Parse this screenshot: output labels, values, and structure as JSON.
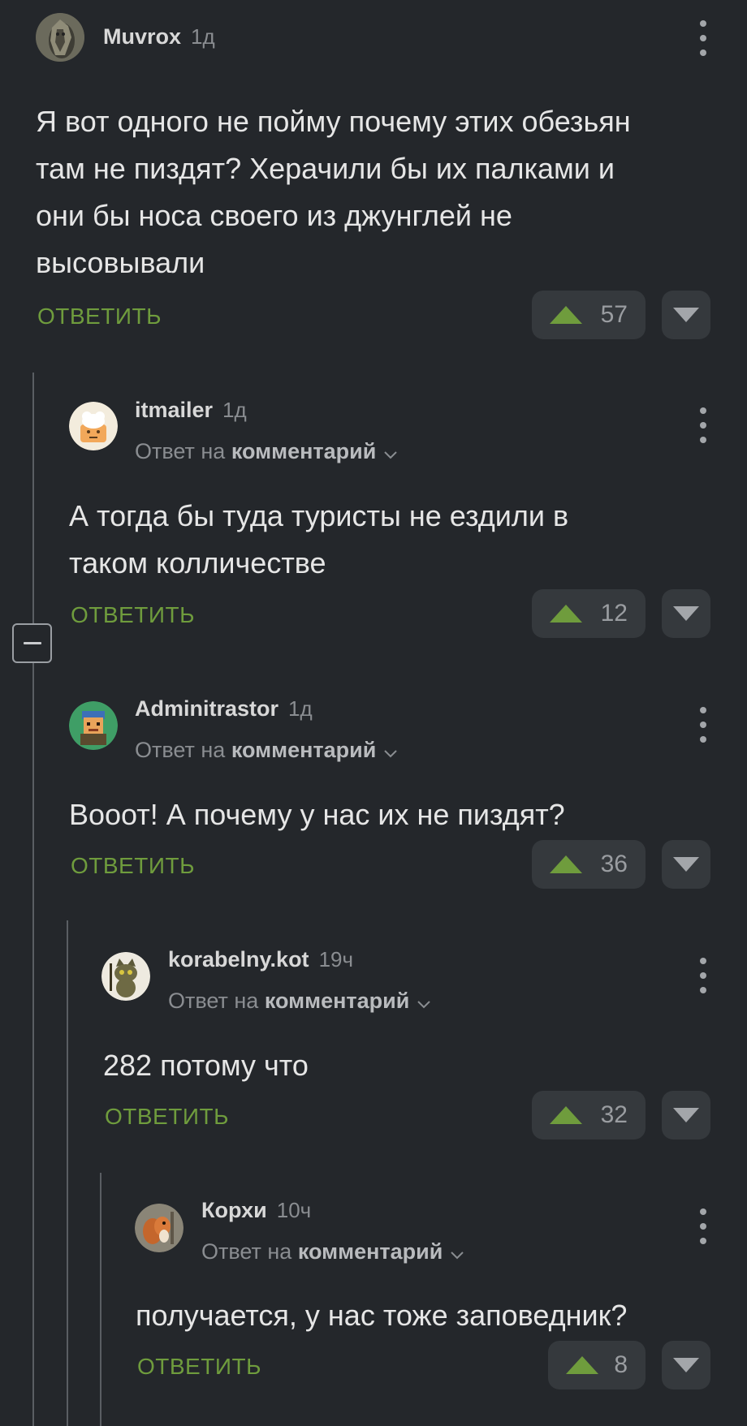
{
  "labels": {
    "reply_prefix": "Ответ на",
    "reply_target": "комментарий",
    "reply_action": "ОТВЕТИТЬ"
  },
  "comments": [
    {
      "username": "Muvrox",
      "time": "1д",
      "avatar_icon": "creature-avatar-icon",
      "text": "Я вот одного не пойму почему этих обезьян там не пиздят? Херачили бы их палками и они бы носа своего из джунглей не высовывали",
      "upvotes": "57"
    },
    {
      "username": "itmailer",
      "time": "1д",
      "avatar_icon": "chef-avatar-icon",
      "text": "А тогда бы туда туристы не ездили в таком колличестве",
      "upvotes": "12"
    },
    {
      "username": "Adminitrastor",
      "time": "1д",
      "avatar_icon": "pixel-character-avatar-icon",
      "text": "Вооот! А почему у нас их не пиздят?",
      "upvotes": "36"
    },
    {
      "username": "korabelny.kot",
      "time": "19ч",
      "avatar_icon": "cat-avatar-icon",
      "text": "282 потому что",
      "upvotes": "32"
    },
    {
      "username": "Корхи",
      "time": "10ч",
      "avatar_icon": "squirrel-avatar-icon",
      "text": "получается, у нас тоже заповедник?",
      "upvotes": "8"
    }
  ],
  "colors": {
    "background": "#24272b",
    "accent_green": "#6f9c3d",
    "button_bg": "#35393d",
    "thread_line": "#5a5e63"
  }
}
